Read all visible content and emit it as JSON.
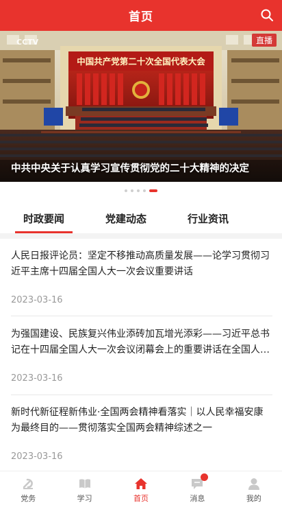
{
  "header": {
    "title": "首页",
    "search_icon": "search-icon"
  },
  "banner": {
    "logo_text": "CCTV",
    "live_badge": "直播",
    "stage_banner": "中国共产党第二十次全国代表大会",
    "caption": "中共中央关于认真学习宣传贯彻党的二十大精神的决定",
    "slide_count": 5,
    "active_slide": 5
  },
  "tabs": [
    {
      "label": "时政要闻",
      "active": true
    },
    {
      "label": "党建动态",
      "active": false
    },
    {
      "label": "行业资讯",
      "active": false
    }
  ],
  "news": [
    {
      "title": "人民日报评论员：坚定不移推动高质量发展——论学习贯彻习近平主席十四届全国人大一次会议重要讲话",
      "date": "2023-03-16"
    },
    {
      "title": "为强国建设、民族复兴伟业添砖加瓦增光添彩——习近平总书记在十四届全国人大一次会议闭幕会上的重要讲话在全国人大代表中引起热烈反响",
      "date": "2023-03-16"
    },
    {
      "title": "新时代新征程新伟业·全国两会精神看落实｜以人民幸福安康为最终目的——贯彻落实全国两会精神综述之一",
      "date": "2023-03-16"
    }
  ],
  "bottom_nav": [
    {
      "label": "党务",
      "icon": "party-emblem-icon",
      "active": false
    },
    {
      "label": "学习",
      "icon": "book-icon",
      "active": false
    },
    {
      "label": "首页",
      "icon": "home-icon",
      "active": true
    },
    {
      "label": "消息",
      "icon": "message-icon",
      "active": false,
      "badge": true
    },
    {
      "label": "我的",
      "icon": "user-icon",
      "active": false
    }
  ],
  "colors": {
    "accent": "#e8332d",
    "text": "#222222",
    "muted": "#999999"
  }
}
